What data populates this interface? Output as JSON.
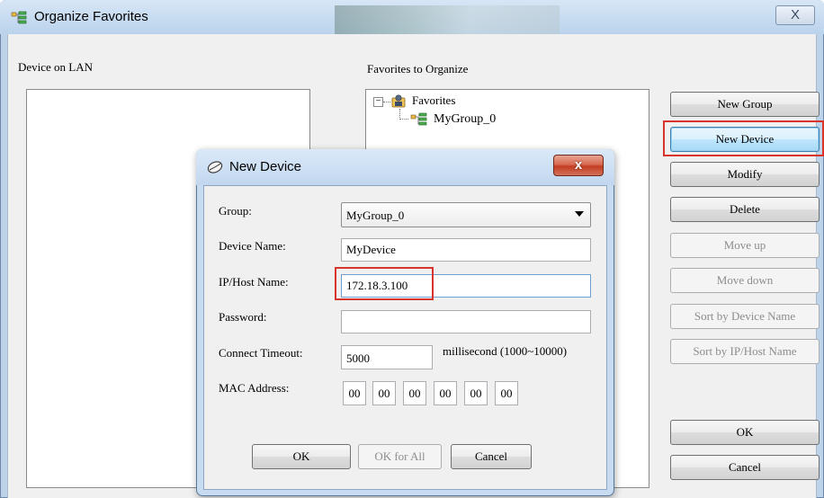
{
  "window": {
    "title": "Organize Favorites",
    "close_glyph": "X"
  },
  "panels": {
    "lan_label": "Device on LAN",
    "favorites_label": "Favorites to Organize"
  },
  "tree": {
    "root_toggle": "−",
    "root_label": "Favorites",
    "children": [
      {
        "label": "MyGroup_0"
      }
    ]
  },
  "side_buttons": {
    "new_group": "New Group",
    "new_device": "New Device",
    "modify": "Modify",
    "delete": "Delete",
    "move_up": "Move up",
    "move_down": "Move down",
    "sort_by_name": "Sort by Device Name",
    "sort_by_ip": "Sort by IP/Host Name",
    "ok": "OK",
    "cancel": "Cancel"
  },
  "dialog": {
    "title": "New Device",
    "close_glyph": "x",
    "fields": {
      "group_label": "Group:",
      "group_value": "MyGroup_0",
      "name_label": "Device Name:",
      "name_value": "MyDevice",
      "ip_label": "IP/Host Name:",
      "ip_value": "172.18.3.100",
      "password_label": "Password:",
      "password_value": "",
      "timeout_label": "Connect Timeout:",
      "timeout_value": "5000",
      "timeout_unit": "millisecond (1000~10000)",
      "mac_label": "MAC Address:",
      "mac": [
        "00",
        "00",
        "00",
        "00",
        "00",
        "00"
      ]
    },
    "buttons": {
      "ok": "OK",
      "ok_for_all": "OK for All",
      "cancel": "Cancel"
    }
  },
  "colors": {
    "highlight": "#d9342b",
    "window_frame": "#bcd3ea",
    "client_bg": "#f0f0f0"
  }
}
